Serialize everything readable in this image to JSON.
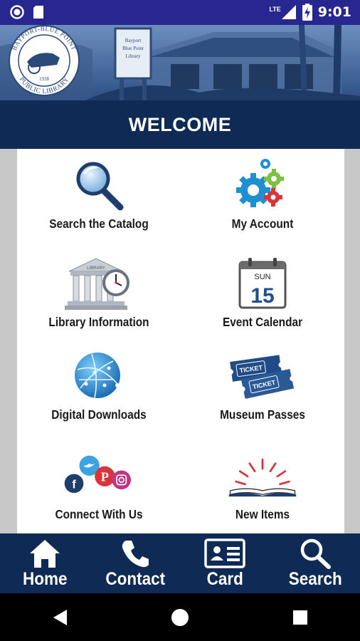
{
  "status_bar": {
    "time": "9:01",
    "network": "LTE",
    "left_icons": [
      "notification-circle-icon",
      "sd-card-icon"
    ],
    "right_icons": [
      "cellular-signal-icon",
      "battery-charging-icon"
    ]
  },
  "header": {
    "logo_top_text": "BAYPORT-BLUE POINT",
    "logo_bottom_text": "PUBLIC LIBRARY",
    "logo_year": "1938",
    "sign_text": "Bayport Blue Point Library"
  },
  "welcome": {
    "title": "WELCOME"
  },
  "menu": {
    "items": [
      {
        "label": "Search the Catalog",
        "icon": "magnifier-icon"
      },
      {
        "label": "My Account",
        "icon": "gears-icon"
      },
      {
        "label": "Library Information",
        "icon": "library-clock-icon"
      },
      {
        "label": "Event Calendar",
        "icon": "calendar-icon",
        "calendar_day": "SUN",
        "calendar_date": "15"
      },
      {
        "label": "Digital Downloads",
        "icon": "globe-network-icon"
      },
      {
        "label": "Museum Passes",
        "icon": "tickets-icon",
        "ticket_text": "TICKET"
      },
      {
        "label": "Connect With Us",
        "icon": "social-bubbles-icon"
      },
      {
        "label": "New Items",
        "icon": "open-book-icon"
      }
    ]
  },
  "bottom_nav": {
    "items": [
      {
        "label": "Home",
        "icon": "home-icon"
      },
      {
        "label": "Contact",
        "icon": "phone-icon"
      },
      {
        "label": "Card",
        "icon": "id-card-icon"
      },
      {
        "label": "Search",
        "icon": "search-icon"
      }
    ]
  },
  "colors": {
    "status_bar": "#27278f",
    "navy": "#0e2a55",
    "content_bg": "#c8c8c8",
    "card_bg": "#ffffff"
  }
}
